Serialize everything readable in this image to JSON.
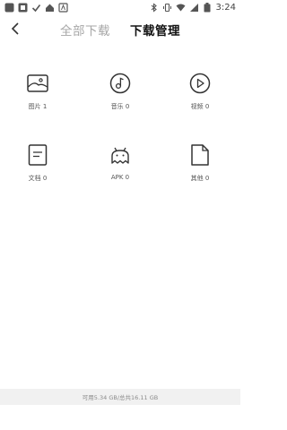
{
  "status_bar": {
    "time": "3:24",
    "left_icons": [
      "app-icon",
      "gallery-icon",
      "check-icon",
      "home-icon",
      "shield-icon"
    ],
    "right_icons": [
      "bluetooth-icon",
      "vibrate-icon",
      "wifi-icon",
      "signal-icon",
      "battery-icon"
    ]
  },
  "header": {
    "tabs": [
      {
        "label": "全部下载",
        "active": false
      },
      {
        "label": "下载管理",
        "active": true
      }
    ]
  },
  "categories": [
    {
      "label": "图片 1",
      "icon": "image-icon"
    },
    {
      "label": "音乐 0",
      "icon": "music-icon"
    },
    {
      "label": "视频 0",
      "icon": "video-icon"
    },
    {
      "label": "文档 0",
      "icon": "document-icon"
    },
    {
      "label": "APK 0",
      "icon": "android-icon"
    },
    {
      "label": "其他 0",
      "icon": "file-icon"
    }
  ],
  "storage": {
    "text": "可用5.34 GB/总共16.11 GB"
  },
  "colors": {
    "icon_stroke": "#333333",
    "footer_bg": "#f1f1f1",
    "inactive_tab": "#a6a6a6"
  }
}
